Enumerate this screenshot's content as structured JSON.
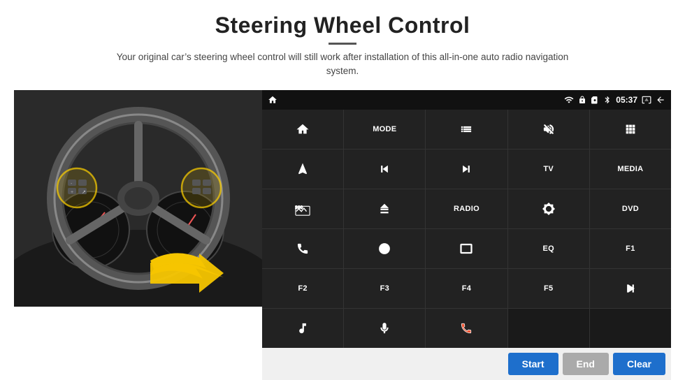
{
  "header": {
    "title": "Steering Wheel Control",
    "subtitle": "Your original car’s steering wheel control will still work after installation of this all-in-one auto radio navigation system."
  },
  "status_bar": {
    "time": "05:37"
  },
  "grid_buttons": [
    {
      "id": "home",
      "type": "icon",
      "label": "home"
    },
    {
      "id": "mode",
      "type": "text",
      "label": "MODE"
    },
    {
      "id": "list",
      "type": "icon",
      "label": "list"
    },
    {
      "id": "mute",
      "type": "icon",
      "label": "mute"
    },
    {
      "id": "apps",
      "type": "icon",
      "label": "apps"
    },
    {
      "id": "nav",
      "type": "icon",
      "label": "nav"
    },
    {
      "id": "prev",
      "type": "icon",
      "label": "prev"
    },
    {
      "id": "next",
      "type": "icon",
      "label": "next"
    },
    {
      "id": "tv",
      "type": "text",
      "label": "TV"
    },
    {
      "id": "media",
      "type": "text",
      "label": "MEDIA"
    },
    {
      "id": "cam360",
      "type": "icon",
      "label": "360cam"
    },
    {
      "id": "eject",
      "type": "icon",
      "label": "eject"
    },
    {
      "id": "radio",
      "type": "text",
      "label": "RADIO"
    },
    {
      "id": "brightness",
      "type": "icon",
      "label": "brightness"
    },
    {
      "id": "dvd",
      "type": "text",
      "label": "DVD"
    },
    {
      "id": "phone",
      "type": "icon",
      "label": "phone"
    },
    {
      "id": "swipe",
      "type": "icon",
      "label": "swipe"
    },
    {
      "id": "screen",
      "type": "icon",
      "label": "screen"
    },
    {
      "id": "eq",
      "type": "text",
      "label": "EQ"
    },
    {
      "id": "f1",
      "type": "text",
      "label": "F1"
    },
    {
      "id": "f2",
      "type": "text",
      "label": "F2"
    },
    {
      "id": "f3",
      "type": "text",
      "label": "F3"
    },
    {
      "id": "f4",
      "type": "text",
      "label": "F4"
    },
    {
      "id": "f5",
      "type": "text",
      "label": "F5"
    },
    {
      "id": "playpause",
      "type": "icon",
      "label": "playpause"
    },
    {
      "id": "music",
      "type": "icon",
      "label": "music"
    },
    {
      "id": "mic",
      "type": "icon",
      "label": "mic"
    },
    {
      "id": "hangup",
      "type": "icon",
      "label": "hangup"
    },
    {
      "id": "empty1",
      "type": "text",
      "label": ""
    },
    {
      "id": "empty2",
      "type": "text",
      "label": ""
    }
  ],
  "bottom_buttons": {
    "start": "Start",
    "end": "End",
    "clear": "Clear"
  },
  "colors": {
    "accent": "#1e6fcc",
    "grid_bg": "#222",
    "grid_gap": "#333",
    "panel_bg": "#1a1a1a",
    "status_bg": "#111"
  }
}
